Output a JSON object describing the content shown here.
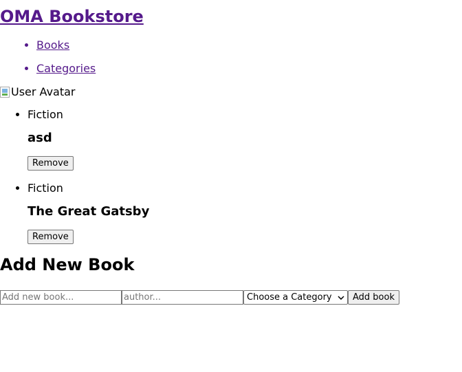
{
  "header": {
    "site_title": "OMA Bookstore"
  },
  "nav": {
    "items": [
      {
        "label": "Books"
      },
      {
        "label": "Categories"
      }
    ]
  },
  "user": {
    "avatar_alt": "User Avatar"
  },
  "books": [
    {
      "category": "Fiction",
      "title": "asd",
      "remove_label": "Remove"
    },
    {
      "category": "Fiction",
      "title": "The Great Gatsby",
      "remove_label": "Remove"
    }
  ],
  "add_form": {
    "heading": "Add New Book",
    "title_placeholder": "Add new book...",
    "author_placeholder": "author...",
    "category_selected": "Choose a Category",
    "submit_label": "Add book"
  },
  "icons": {
    "broken_image": "broken-image-icon",
    "dropdown": "chevron-down-icon"
  },
  "colors": {
    "link": "#551a8b",
    "button_bg": "#efefef"
  }
}
